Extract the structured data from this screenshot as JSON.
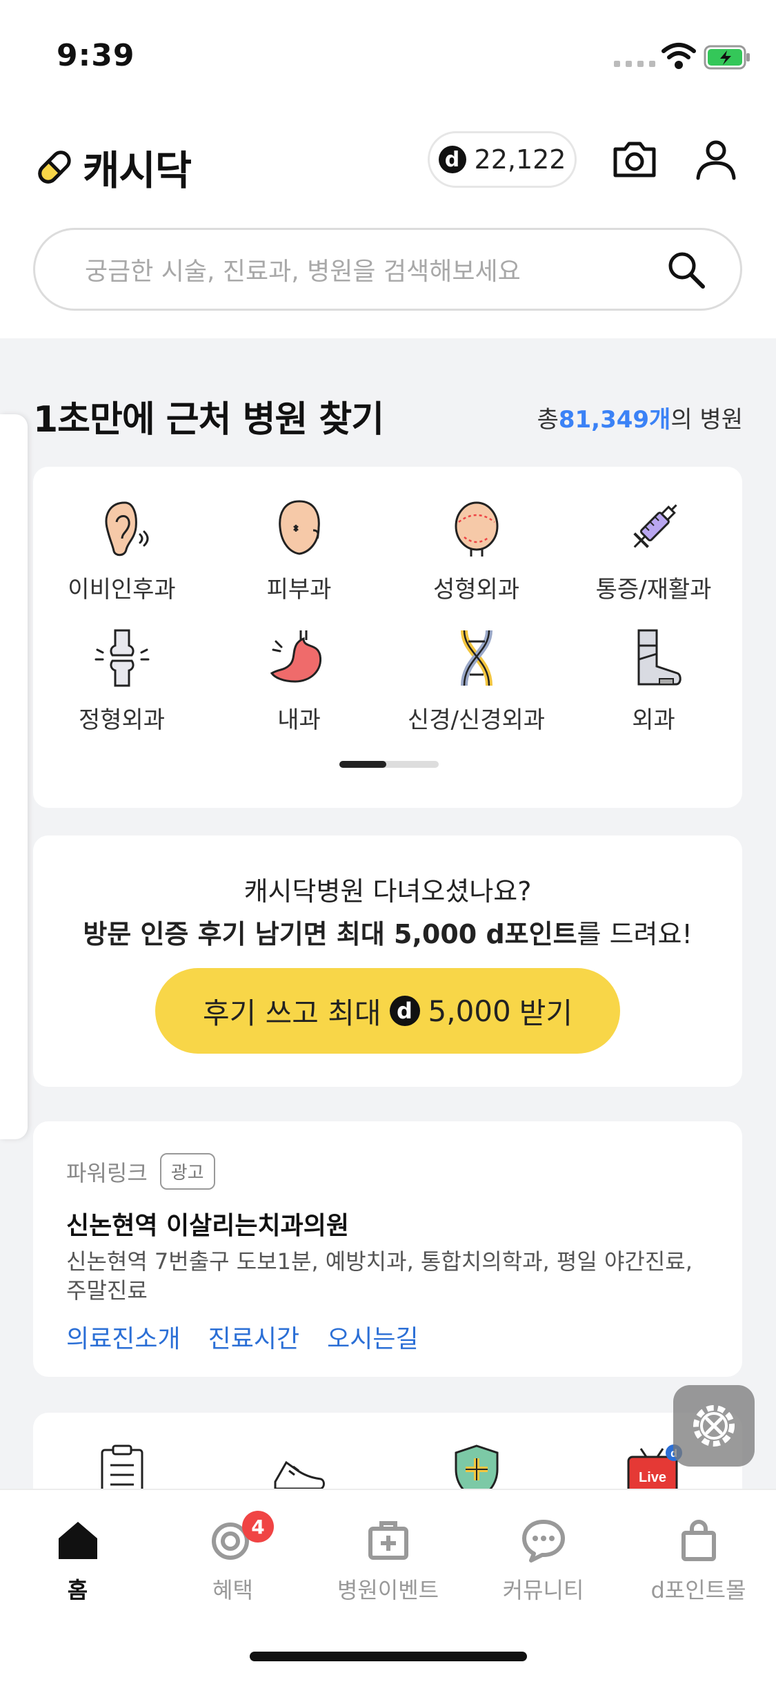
{
  "status_bar": {
    "time": "9:39"
  },
  "header": {
    "app_name": "캐시닥",
    "points_badge": "d",
    "points": "22,122"
  },
  "search": {
    "placeholder": "궁금한 시술, 진료과, 병원을 검색해보세요"
  },
  "nearby": {
    "title": "1초만에 근처 병원 찾기",
    "count_prefix": "총 ",
    "count": "81,349개",
    "count_suffix": "의 병원",
    "categories": [
      {
        "label": "이비인후과",
        "icon": "ear-icon"
      },
      {
        "label": "피부과",
        "icon": "face-icon"
      },
      {
        "label": "성형외과",
        "icon": "head-surgery-icon"
      },
      {
        "label": "통증/재활과",
        "icon": "syringe-icon"
      },
      {
        "label": "정형외과",
        "icon": "bone-joint-icon"
      },
      {
        "label": "내과",
        "icon": "stomach-icon"
      },
      {
        "label": "신경/신경외과",
        "icon": "dna-icon"
      },
      {
        "label": "외과",
        "icon": "cast-leg-icon"
      }
    ],
    "page_progress": 0.47
  },
  "review": {
    "question": "캐시닥병원 다녀오셨나요?",
    "line_bold": "방문 인증 후기 남기면 최대 5,000 d포인트",
    "line_rest": "를 드려요!",
    "button_prefix": "후기 쓰고 최대",
    "button_badge": "d",
    "button_amount": "5,000",
    "button_suffix": "받기"
  },
  "ad": {
    "label": "파워링크",
    "tag": "광고",
    "title": "신논현역 이살리는치과의원",
    "description": "신논현역 7번출구 도보1분, 예방치과, 통합치의학과, 평일 야간진료, 주말진료",
    "links": [
      "의료진소개",
      "진료시간",
      "오시는길"
    ]
  },
  "tabbar": {
    "tabs": [
      {
        "label": "홈",
        "icon": "home-icon",
        "active": true
      },
      {
        "label": "혜택",
        "icon": "target-icon",
        "badge": "4"
      },
      {
        "label": "병원이벤트",
        "icon": "medical-bag-icon"
      },
      {
        "label": "커뮤니티",
        "icon": "chat-icon"
      },
      {
        "label": "d포인트몰",
        "icon": "shopping-bag-icon"
      }
    ]
  },
  "colors": {
    "accent_blue": "#3b82f6",
    "cta_yellow": "#f8d648",
    "badge_red": "#f04444",
    "link_blue": "#2b6fd6"
  }
}
